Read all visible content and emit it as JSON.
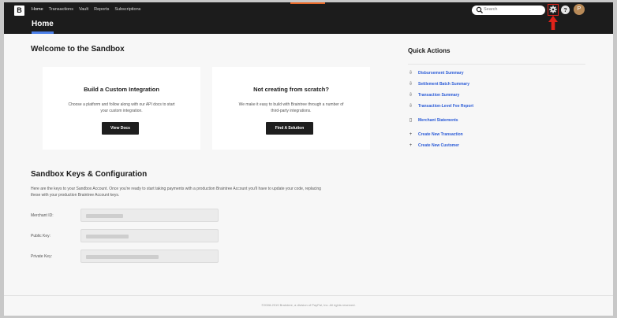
{
  "header": {
    "logo": "B",
    "nav": [
      "Home",
      "Transactions",
      "Vault",
      "Reports",
      "Subscriptions"
    ],
    "page_title": "Home",
    "search_placeholder": "Search",
    "avatar_initial": "P",
    "help": "?",
    "accent_color": "#4b7fe8",
    "highlight_color": "#e0231a"
  },
  "welcome": {
    "title": "Welcome to the Sandbox",
    "cards": [
      {
        "title": "Build a Custom Integration",
        "desc_lines": [
          "Choose a platform and follow along with our API docs to start",
          "your custom integration."
        ],
        "button": "View Docs"
      },
      {
        "title": "Not creating from scratch?",
        "desc_lines": [
          "We make it easy to build with Braintree through a number of",
          "third-party integrations."
        ],
        "button": "Find A Solution"
      }
    ]
  },
  "keys": {
    "title": "Sandbox Keys & Configuration",
    "desc_lines": [
      "Here are the keys to your Sandbox Account. Once you're ready to start taking payments with a production Braintree Account you'll have to update your code, replacing",
      "these with your production Braintree Account keys."
    ],
    "fields": [
      {
        "label": "Merchant ID:",
        "mask_fraction": 0.27
      },
      {
        "label": "Public Key:",
        "mask_fraction": 0.31
      },
      {
        "label": "Private Key:",
        "mask_fraction": 0.53
      }
    ]
  },
  "quick_actions": {
    "title": "Quick Actions",
    "items": [
      {
        "label": "Disbursement Summary",
        "icon": "download-icon"
      },
      {
        "label": "Settlement Batch Summary",
        "icon": "download-icon"
      },
      {
        "label": "Transaction Summary",
        "icon": "download-icon"
      },
      {
        "label": "Transaction-Level Fee Report",
        "icon": "download-icon"
      },
      {
        "label": "Merchant Statements",
        "icon": "document-icon"
      },
      {
        "label": "Create New Transaction",
        "icon": "plus-icon"
      },
      {
        "label": "Create New Customer",
        "icon": "plus-icon"
      }
    ]
  },
  "footer": {
    "text": "©2008-2019 Braintree, a division of PayPal, Inc. All rights reserved."
  }
}
